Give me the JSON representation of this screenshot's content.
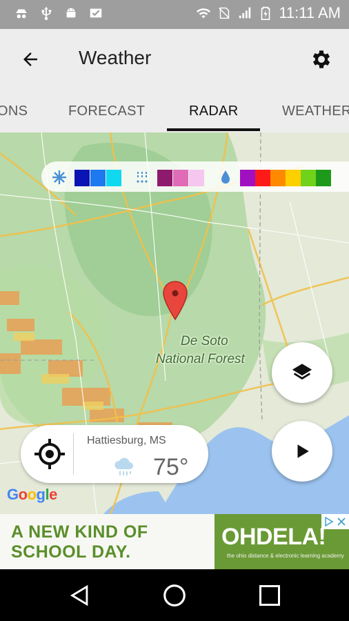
{
  "status_bar": {
    "time": "11:11 AM",
    "left_icons": [
      "incognito-icon",
      "usb-icon",
      "android-icon",
      "ticket-check-icon"
    ],
    "right_icons": [
      "wifi-icon",
      "no-sim-icon",
      "signal-icon",
      "battery-charging-icon"
    ]
  },
  "app_bar": {
    "title": "Weather",
    "back_icon": "arrow-left-icon",
    "settings_icon": "gear-icon"
  },
  "tabs": [
    {
      "label": "ONS",
      "active": false
    },
    {
      "label": "FORECAST",
      "active": false
    },
    {
      "label": "RADAR",
      "active": true
    },
    {
      "label": "WEATHER",
      "active": false
    }
  ],
  "map": {
    "place_label_1": "De Soto",
    "place_label_2": "National Forest",
    "attribution": "Google",
    "legend": {
      "snow_colors": [
        "#0a14b4",
        "#1e78f0",
        "#10d8f0"
      ],
      "mix_colors": [
        "#8e1a6e",
        "#e06cb8",
        "#f5c6ee"
      ],
      "rain_colors": [
        "#a010c0",
        "#ff1a1a",
        "#ff8a00",
        "#ffd000",
        "#70d21a",
        "#1e9a1a"
      ]
    }
  },
  "location_card": {
    "city": "Hattiesburg, MS",
    "temperature": "75°",
    "condition_icon": "cloud-rain-icon"
  },
  "ad": {
    "headline_line1": "A NEW KIND OF",
    "headline_line2": "SCHOOL DAY.",
    "brand": "OHDELA!",
    "tagline": "the ohio distance & electronic learning academy"
  }
}
